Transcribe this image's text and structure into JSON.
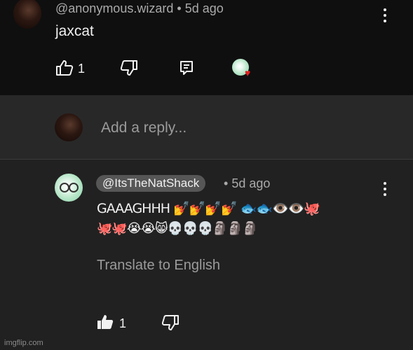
{
  "comment": {
    "author": "@anonymous.wizard",
    "separator": "•",
    "age": "5d ago",
    "text": "jaxcat",
    "likes": "1",
    "icons": [
      "thumbs-up-icon",
      "thumbs-down-icon",
      "reply-icon",
      "creator-heart-avatar",
      "more-options-icon"
    ]
  },
  "reply_box": {
    "placeholder": "Add a reply..."
  },
  "reply": {
    "author": "@ItsTheNatShack",
    "separator": "•",
    "age": "5d ago",
    "line1": "GAAAGHHH 💅💅💅💅 🐟🐟👁️👁️🐙",
    "line2": "🐙🐙😭😭😸💀💀💀🗿🗿🗿",
    "translate": "Translate to English",
    "likes": "1"
  },
  "watermark": "imgflip.com",
  "colors": {
    "background": "#212121",
    "top_comment_bg": "#0f0f0f",
    "reply_box_bg": "#282828",
    "chip_bg": "#565656",
    "heart": "#e02020"
  }
}
